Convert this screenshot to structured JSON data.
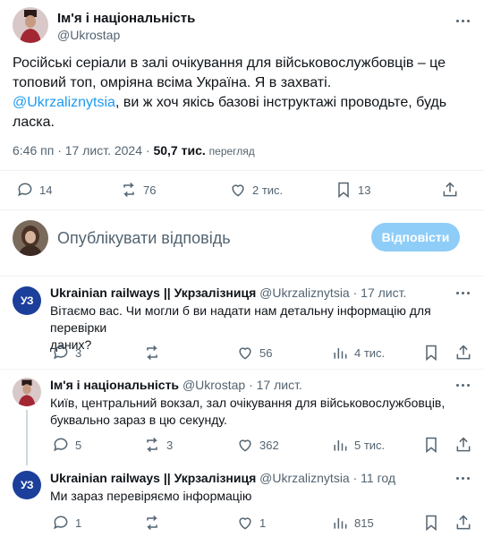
{
  "post": {
    "author_name": "Ім'я і національність",
    "author_handle": "@Ukrostap",
    "text_line1": "Російські серіали в залі очікування для військовослужбовців – це",
    "text_line2": "топовий топ, омріяна всіма Україна. Я в захваті.",
    "mention": "@Ukrzaliznytsia",
    "text_line3_rest": ", ви ж хоч якісь базові інструктажі проводьте, будь",
    "text_line4": "ласка.",
    "time": "6:46 пп",
    "date": "17 лист. 2024",
    "separator": "·",
    "views_count": "50,7 тис.",
    "views_label": "перегляд",
    "replies": "14",
    "reposts": "76",
    "likes": "2 тис.",
    "bookmarks": "13"
  },
  "compose": {
    "placeholder": "Опублікувати відповідь",
    "button": "Відповісти"
  },
  "replies": [
    {
      "name": "Ukrainian railways || Укрзалізниця",
      "handle": "@Ukrzaliznytsia",
      "time": "· 17 лист.",
      "line1": "Вітаємо вас. Чи могли б ви надати нам детальну інформацію для перевірки",
      "line2": "даних?",
      "replies": "3",
      "reposts": "",
      "likes": "56",
      "views": "4 тис.",
      "logo": "УЗ"
    },
    {
      "name": "Ім'я і національність",
      "handle": "@Ukrostap",
      "time": "· 17 лист.",
      "line1": "Київ, центральний вокзал, зал очікування для військовослужбовців,",
      "line2": "буквально зараз в цю секунду.",
      "replies": "5",
      "reposts": "3",
      "likes": "362",
      "views": "5 тис."
    },
    {
      "name": "Ukrainian railways || Укрзалізниця",
      "handle": "@Ukrzaliznytsia",
      "time": "· 11 год",
      "line1": "Ми зараз перевіряємо інформацію",
      "replies": "1",
      "reposts": "",
      "likes": "1",
      "views": "815",
      "logo": "УЗ"
    }
  ],
  "icons": [
    "reply-icon",
    "repost-icon",
    "like-icon",
    "bookmark-icon",
    "share-icon",
    "views-icon",
    "more-icon"
  ]
}
